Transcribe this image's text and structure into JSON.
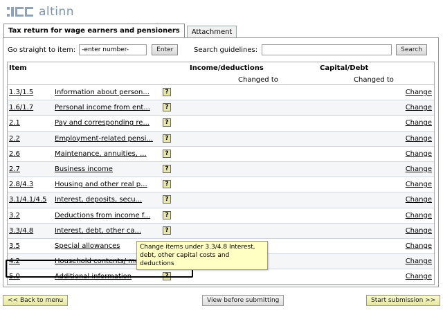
{
  "brand": {
    "name": "altinn"
  },
  "tabs": [
    {
      "label": "Tax return for wage earners and pensioners"
    },
    {
      "label": "Attachment"
    }
  ],
  "goto": {
    "label": "Go straight to item:",
    "value": "-enter number-",
    "button": "Enter"
  },
  "search": {
    "label": "Search guidelines:",
    "value": "",
    "button": "Search"
  },
  "table": {
    "col_item": "Item",
    "col_income": "Income/deductions",
    "col_capital": "Capital/Debt",
    "sub_income": "Changed to",
    "sub_capital": "Changed to",
    "rows": [
      {
        "code": "1.3/1.5",
        "desc": "Information about person...",
        "help": "?",
        "change": "Change"
      },
      {
        "code": "1.6/1.7",
        "desc": "Personal income from ent...",
        "help": "?",
        "change": "Change"
      },
      {
        "code": "2.1",
        "desc": "Pay and corresponding re...",
        "help": "?",
        "change": "Change"
      },
      {
        "code": "2.2",
        "desc": "Employment-related pensi...",
        "help": "?",
        "change": "Change"
      },
      {
        "code": "2.6",
        "desc": "Maintenance, annuities, ...",
        "help": "?",
        "change": "Change"
      },
      {
        "code": "2.7",
        "desc": "Business income",
        "help": "?",
        "change": "Change"
      },
      {
        "code": "2.8/4.3",
        "desc": "Housing and other real p...",
        "help": "?",
        "change": "Change"
      },
      {
        "code": "3.1/4.1/4.5",
        "desc": "Interest, deposits, secu...",
        "help": "?",
        "change": "Change"
      },
      {
        "code": "3.2",
        "desc": "Deductions from income f...",
        "help": "?",
        "change": "Change"
      },
      {
        "code": "3.3/4.8",
        "desc": "Interest, debt, other ca...",
        "help": "?",
        "change": "Change"
      },
      {
        "code": "3.5",
        "desc": "Special allowances",
        "help": "?",
        "change": "Change"
      },
      {
        "code": "4.2",
        "desc": "Household contents/ move...",
        "help": "?",
        "change": "Change"
      },
      {
        "code": "5.0",
        "desc": "Additional information",
        "help": "?",
        "change": "Change"
      }
    ]
  },
  "tooltip": {
    "text": "Change items under 3.3/4.8 Interest, debt, other capital costs and deductions"
  },
  "footer": {
    "back": "<< Back to menu",
    "view": "View before submitting",
    "start": "Start submission >>"
  }
}
